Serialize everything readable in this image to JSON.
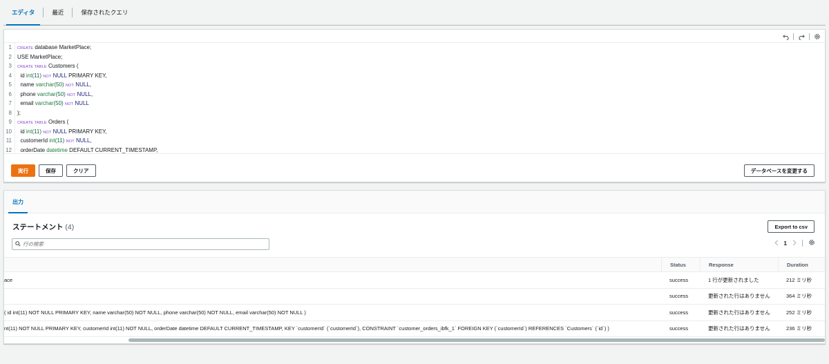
{
  "tabs": [
    {
      "label": "エディタ",
      "active": true
    },
    {
      "label": "最近",
      "active": false
    },
    {
      "label": "保存されたクエリ",
      "active": false
    }
  ],
  "editor": {
    "lines": [
      {
        "n": "1",
        "tokens": [
          [
            "kw",
            "CREATE"
          ],
          [
            "t",
            " database MarketPlace;"
          ]
        ]
      },
      {
        "n": "2",
        "tokens": [
          [
            "t",
            "USE MarketPlace;"
          ]
        ]
      },
      {
        "n": "3",
        "tokens": [
          [
            "kw",
            "CREATE TABLE"
          ],
          [
            "t",
            " Customers ("
          ]
        ]
      },
      {
        "n": "4",
        "tokens": [
          [
            "t",
            "  id "
          ],
          [
            "ty",
            "int"
          ],
          [
            "num",
            "(11)"
          ],
          [
            "t",
            " "
          ],
          [
            "kw",
            "NOT"
          ],
          [
            "kw2",
            " NULL"
          ],
          [
            "t",
            " PRIMARY KEY,"
          ]
        ]
      },
      {
        "n": "5",
        "tokens": [
          [
            "t",
            "  name "
          ],
          [
            "ty",
            "varchar"
          ],
          [
            "num",
            "(50)"
          ],
          [
            "t",
            " "
          ],
          [
            "kw",
            "NOT"
          ],
          [
            "kw2",
            " NULL"
          ],
          [
            "t",
            ","
          ]
        ]
      },
      {
        "n": "6",
        "tokens": [
          [
            "t",
            "  phone "
          ],
          [
            "ty",
            "varchar"
          ],
          [
            "num",
            "(50)"
          ],
          [
            "t",
            " "
          ],
          [
            "kw",
            "NOT"
          ],
          [
            "kw2",
            " NULL"
          ],
          [
            "t",
            ","
          ]
        ]
      },
      {
        "n": "7",
        "tokens": [
          [
            "t",
            "  email "
          ],
          [
            "ty",
            "varchar"
          ],
          [
            "num",
            "(50)"
          ],
          [
            "t",
            " "
          ],
          [
            "kw",
            "NOT"
          ],
          [
            "kw2",
            " NULL"
          ]
        ]
      },
      {
        "n": "8",
        "tokens": [
          [
            "t",
            ");"
          ]
        ]
      },
      {
        "n": "9",
        "tokens": [
          [
            "kw",
            "CREATE TABLE"
          ],
          [
            "t",
            " Orders ("
          ]
        ]
      },
      {
        "n": "10",
        "tokens": [
          [
            "t",
            "  id "
          ],
          [
            "ty",
            "int"
          ],
          [
            "num",
            "(11)"
          ],
          [
            "t",
            " "
          ],
          [
            "kw",
            "NOT"
          ],
          [
            "kw2",
            " NULL"
          ],
          [
            "t",
            " PRIMARY KEY,"
          ]
        ]
      },
      {
        "n": "11",
        "tokens": [
          [
            "t",
            "  customerId "
          ],
          [
            "ty",
            "int"
          ],
          [
            "num",
            "(11)"
          ],
          [
            "t",
            " "
          ],
          [
            "kw",
            "NOT"
          ],
          [
            "kw2",
            " NULL"
          ],
          [
            "t",
            ","
          ]
        ]
      },
      {
        "n": "12",
        "tokens": [
          [
            "t",
            "  orderDate "
          ],
          [
            "ty",
            "datetime"
          ],
          [
            "t",
            " DEFAULT CURRENT_TIMESTAMP,"
          ]
        ]
      }
    ],
    "run_label": "実行",
    "save_label": "保存",
    "clear_label": "クリア",
    "change_db_label": "データベースを変更する"
  },
  "output": {
    "tab_label": "出力",
    "title": "ステートメント",
    "count": "(4)",
    "export_label": "Export to csv",
    "search_placeholder": "行の検索",
    "page": "1",
    "columns": {
      "status": "Status",
      "response": "Response",
      "duration": "Duration"
    },
    "rows": [
      {
        "statement": "ace",
        "status": "success",
        "response": "1 行が更新されました",
        "duration": "212 ミリ秒"
      },
      {
        "statement": "",
        "status": "success",
        "response": "更新された行はありません",
        "duration": "364 ミリ秒"
      },
      {
        "statement": "( id int(11) NOT NULL PRIMARY KEY, name varchar(50) NOT NULL, phone varchar(50) NOT NULL, email varchar(50) NOT NULL )",
        "status": "success",
        "response": "更新された行はありません",
        "duration": "252 ミリ秒"
      },
      {
        "statement": "nt(11) NOT NULL PRIMARY KEY, customerId int(11) NOT NULL, orderDate datetime DEFAULT CURRENT_TIMESTAMP, KEY `customerId` (`customerId`), CONSTRAINT `customer_orders_ibfk_1` FOREIGN KEY (`customerId`) REFERENCES `Customers` (`id`) )",
        "status": "success",
        "response": "更新された行はありません",
        "duration": "236 ミリ秒"
      }
    ]
  }
}
